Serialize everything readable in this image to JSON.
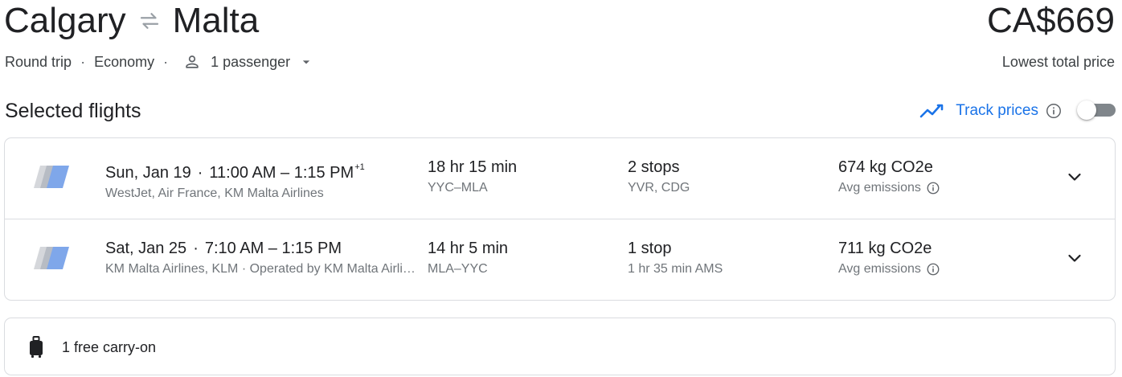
{
  "header": {
    "origin": "Calgary",
    "destination": "Malta",
    "price": "CA$669",
    "price_caption": "Lowest total price"
  },
  "trip_options": {
    "trip_type": "Round trip",
    "cabin": "Economy",
    "passengers": "1 passenger"
  },
  "selected": {
    "title": "Selected flights",
    "track_prices_label": "Track prices",
    "track_prices_enabled": false
  },
  "flights": [
    {
      "date": "Sun, Jan 19",
      "depart": "11:00 AM",
      "arrive": "1:15 PM",
      "day_offset": "+1",
      "airlines": "WestJet, Air France, KM Malta Airlines",
      "duration": "18 hr 15 min",
      "route": "YYC–MLA",
      "stops": "2 stops",
      "stop_detail": "YVR, CDG",
      "emissions": "674 kg CO2e",
      "emissions_label": "Avg emissions"
    },
    {
      "date": "Sat, Jan 25",
      "depart": "7:10 AM",
      "arrive": "1:15 PM",
      "airlines": "KM Malta Airlines, KLM · Operated by KM Malta Airlines",
      "duration": "14 hr 5 min",
      "route": "MLA–YYC",
      "stops": "1 stop",
      "stop_detail": "1 hr 35 min AMS",
      "emissions": "711 kg CO2e",
      "emissions_label": "Avg emissions"
    }
  ],
  "baggage": {
    "label": "1 free carry-on"
  },
  "colors": {
    "accent": "#1a73e8",
    "text": "#202124",
    "muted": "#70757a",
    "border": "#dadce0"
  }
}
